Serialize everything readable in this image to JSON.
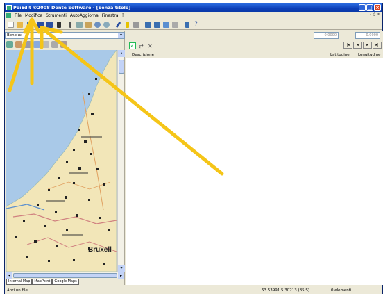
{
  "window": {
    "title": "PoiEdit ©2008 Donte Software - [Senza titolo]"
  },
  "menubar": {
    "items": [
      "File",
      "Modifica",
      "Strumenti",
      "AutoAggiorna",
      "Finestra",
      "?"
    ],
    "right_controls": "- ₫ ×"
  },
  "left_pane": {
    "combo_value": "Benelux",
    "map_labels": {
      "big_city": "Bruxell"
    },
    "map_tabs": [
      "Internal Map",
      "MapPoint",
      "Google Maps"
    ]
  },
  "right_pane": {
    "coord_1": "0.0000",
    "coord_2": "0.0000",
    "columns": {
      "descrizione": "Descrizione",
      "latitudine": "Latitudine",
      "longitudine": "Longitudine"
    }
  },
  "statusbar": {
    "left": "Apri un file",
    "coords": "53.53991 5.30213 (85 S)",
    "count": "0 elementi"
  },
  "colors": {
    "title_bar": "#0d3fb8",
    "annotation_arrow": "#f5c518",
    "sea": "#a9c9e8",
    "land": "#f2e6b8"
  }
}
